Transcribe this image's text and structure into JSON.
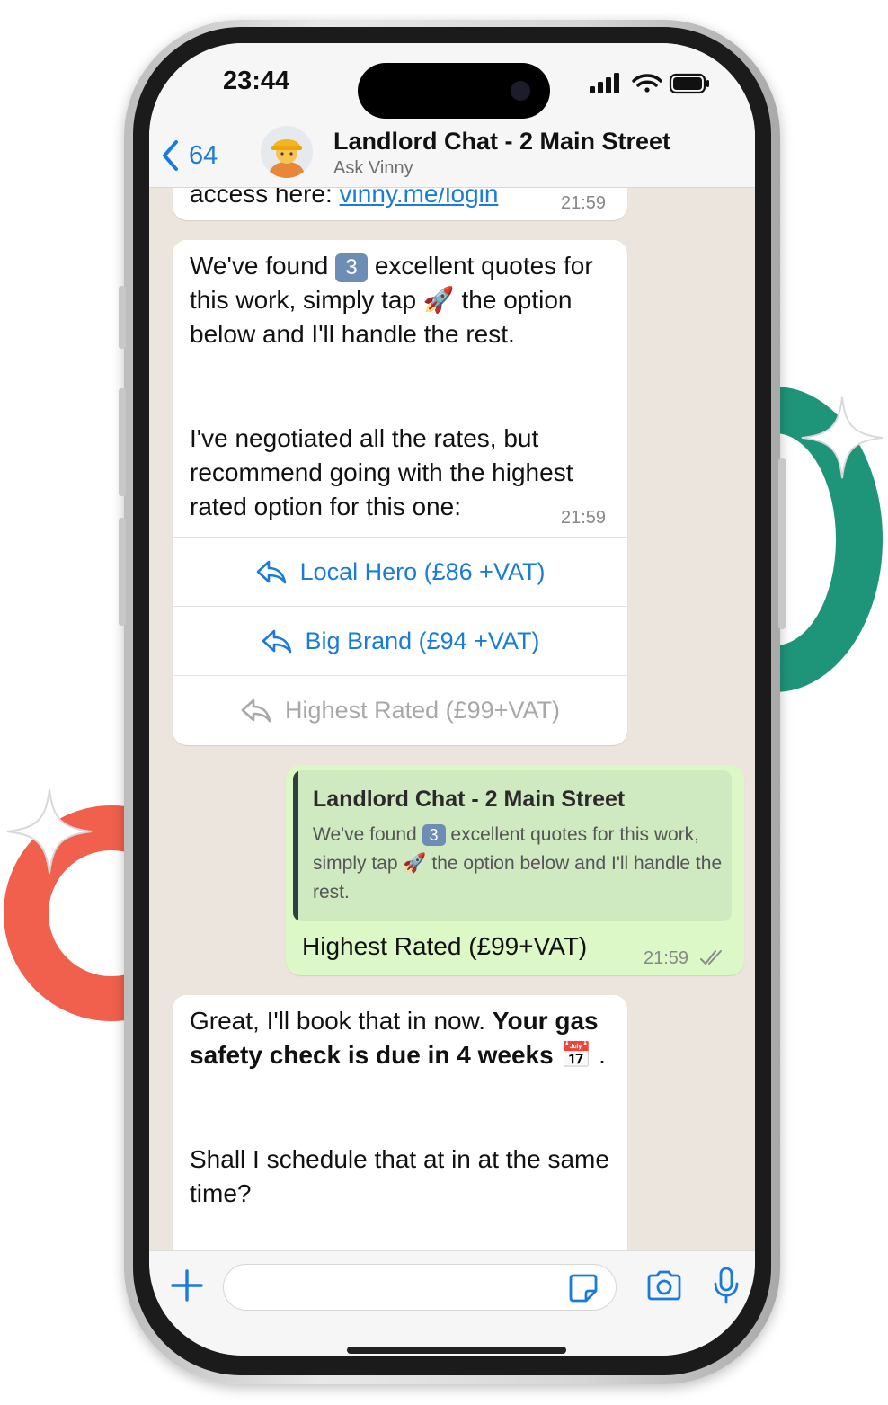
{
  "status_bar": {
    "time": "23:44"
  },
  "header": {
    "back_count": "64",
    "title": "Landlord Chat - 2 Main Street",
    "subtitle": "Ask Vinny"
  },
  "messages": [
    {
      "direction": "incoming",
      "text_prefix": "access here: ",
      "link_text": "vinny.me/login",
      "time": "21:59"
    },
    {
      "direction": "incoming",
      "para1": {
        "a": "We've found",
        "num_emoji": "3",
        "b": "excellent quotes for this work, simply tap",
        "rocket": "🚀",
        "c": "the option below and I'll handle the rest."
      },
      "para2": "I've negotiated all the rates, but recommend going with the highest rated option for this one:",
      "time": "21:59",
      "quick_replies": [
        {
          "label": "Local Hero (£86 +VAT)",
          "enabled": true
        },
        {
          "label": "Big Brand (£94 +VAT)",
          "enabled": true
        },
        {
          "label": "Highest Rated (£99+VAT)",
          "enabled": false
        }
      ]
    },
    {
      "direction": "outgoing",
      "quote_title": "Landlord Chat - 2 Main Street",
      "quote": {
        "a": "We've found",
        "num_emoji": "3",
        "b": "excellent quotes for this work, simply tap",
        "rocket": "🚀",
        "c": "the option below and I'll handle the rest."
      },
      "text": "Highest Rated (£99+VAT)",
      "time": "21:59",
      "status": "read"
    },
    {
      "direction": "incoming",
      "plain": "Great, I'll book that in now. ",
      "bold": "Your gas safety check is due in 4 weeks",
      "calendar_emoji": "📅",
      "after": " .",
      "para2": "Shall I schedule that at in at the same time?"
    }
  ],
  "composer": {
    "placeholder": ""
  },
  "colors": {
    "accent": "#1A7CD8",
    "outgoing_bubble": "#DCF8C6",
    "chat_background": "#ECE5DD",
    "deco_red": "#F0604C",
    "deco_green": "#1E9579"
  },
  "icons": {
    "back": "chevron-left-icon",
    "signal": "signal-icon",
    "wifi": "wifi-icon",
    "battery": "battery-icon",
    "reply": "reply-arrow-icon",
    "read_receipt": "double-check-icon",
    "plus": "plus-icon",
    "sticker": "sticker-icon",
    "camera": "camera-icon",
    "mic": "microphone-icon"
  }
}
